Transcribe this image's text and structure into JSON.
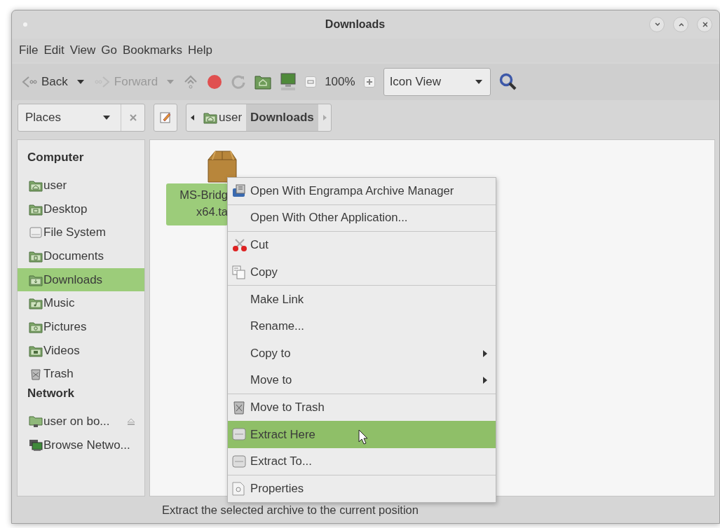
{
  "window": {
    "title": "Downloads"
  },
  "menubar": [
    "File",
    "Edit",
    "View",
    "Go",
    "Bookmarks",
    "Help"
  ],
  "toolbar": {
    "back": {
      "label": "Back",
      "disabled": false
    },
    "forward": {
      "label": "Forward",
      "disabled": true
    },
    "zoom": "100%",
    "view_select": "Icon View"
  },
  "location_bar": {
    "side_pane_select": "Places",
    "path": [
      {
        "label": "user",
        "selected": false
      },
      {
        "label": "Downloads",
        "selected": true
      }
    ]
  },
  "sidebar": {
    "sections": [
      {
        "heading": "Computer",
        "items": [
          {
            "label": "user",
            "selected": false
          },
          {
            "label": "Desktop",
            "selected": false
          },
          {
            "label": "File System",
            "selected": false
          },
          {
            "label": "Documents",
            "selected": false
          },
          {
            "label": "Downloads",
            "selected": true
          },
          {
            "label": "Music",
            "selected": false
          },
          {
            "label": "Pictures",
            "selected": false
          },
          {
            "label": "Videos",
            "selected": false
          },
          {
            "label": "Trash",
            "selected": false
          }
        ]
      },
      {
        "heading": "Network",
        "items": [
          {
            "label": "user on bo...",
            "selected": false
          },
          {
            "label": "Browse Netwo...",
            "selected": false
          }
        ]
      }
    ]
  },
  "files": [
    {
      "name_lines": [
        "MS-Bridg",
        "x64.ta"
      ],
      "selected": true
    }
  ],
  "context_menu": [
    {
      "label": "Open With Engrampa Archive Manager",
      "submenu": false,
      "selected": false,
      "separator_after": true
    },
    {
      "label": "Open With Other Application...",
      "submenu": false,
      "selected": false,
      "separator_after": true
    },
    {
      "label": "Cut",
      "submenu": false,
      "selected": false,
      "separator_after": false
    },
    {
      "label": "Copy",
      "submenu": false,
      "selected": false,
      "separator_after": true
    },
    {
      "label": "Make Link",
      "submenu": false,
      "selected": false,
      "separator_after": false
    },
    {
      "label": "Rename...",
      "submenu": false,
      "selected": false,
      "separator_after": false
    },
    {
      "label": "Copy to",
      "submenu": true,
      "selected": false,
      "separator_after": false
    },
    {
      "label": "Move to",
      "submenu": true,
      "selected": false,
      "separator_after": true
    },
    {
      "label": "Move to Trash",
      "submenu": false,
      "selected": false,
      "separator_after": false
    },
    {
      "label": "Extract Here",
      "submenu": false,
      "selected": true,
      "separator_after": false
    },
    {
      "label": "Extract To...",
      "submenu": false,
      "selected": false,
      "separator_after": true
    },
    {
      "label": "Properties",
      "submenu": false,
      "selected": false,
      "separator_after": false
    }
  ],
  "status_bar": "Extract the selected archive to the current position"
}
